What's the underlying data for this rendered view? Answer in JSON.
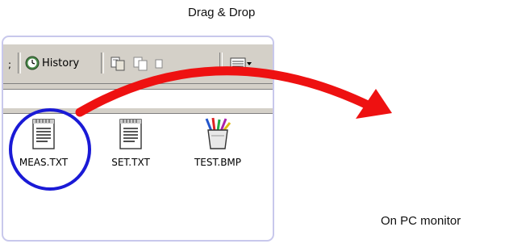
{
  "captions": {
    "drag": "Drag & Drop",
    "pc": "On PC monitor"
  },
  "toolbar": {
    "fragment": ";",
    "history_label": "History",
    "icons": [
      "history-icon",
      "move-to-icon",
      "copy-to-icon",
      "views-icon"
    ]
  },
  "files": [
    {
      "name": "MEAS.TXT",
      "icon": "text-file-icon",
      "highlighted": true
    },
    {
      "name": "SET.TXT",
      "icon": "text-file-icon",
      "highlighted": false
    },
    {
      "name": "TEST.BMP",
      "icon": "bitmap-file-icon",
      "highlighted": false
    }
  ],
  "colors": {
    "arrow": "#ee1111",
    "highlight_circle": "#1a1ad6",
    "window_border": "#c8c8ec",
    "toolbar_bg": "#d4d0c8"
  }
}
